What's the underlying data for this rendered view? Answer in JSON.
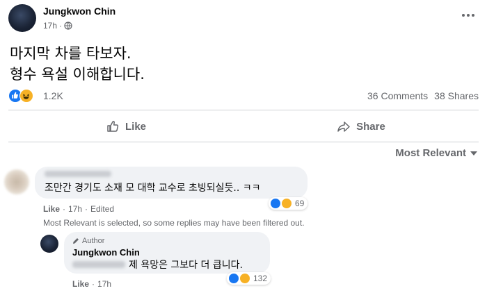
{
  "post": {
    "author": "Jungkwon Chin",
    "time": "17h",
    "privacy_icon": "globe-icon",
    "body_lines": [
      "마지막 차를 타보자.",
      "형수 욕설 이해합니다."
    ],
    "reaction_count": "1.2K",
    "reactions": [
      "like",
      "haha"
    ],
    "comments_count": "36 Comments",
    "shares_count": "38 Shares"
  },
  "actions": {
    "like_label": "Like",
    "share_label": "Share"
  },
  "sort": {
    "label": "Most Relevant"
  },
  "comment": {
    "text": "조만간 경기도 소재 모 대학 교수로 초빙되실듯.. ㅋㅋ",
    "reaction_count": "69",
    "like_label": "Like",
    "time": "17h",
    "edited": "Edited"
  },
  "filter_note": "Most Relevant is selected, so some replies may have been filtered out.",
  "reply": {
    "badge": "Author",
    "author": "Jungkwon Chin",
    "text": "제 욕망은 그보다 더 큽니다.",
    "reaction_count": "132",
    "like_label": "Like",
    "time": "17h"
  },
  "colors": {
    "like_blue": "#1877f2",
    "haha_yellow": "#f7b125",
    "muted_text": "#65676b",
    "bubble_bg": "#f0f2f5"
  }
}
